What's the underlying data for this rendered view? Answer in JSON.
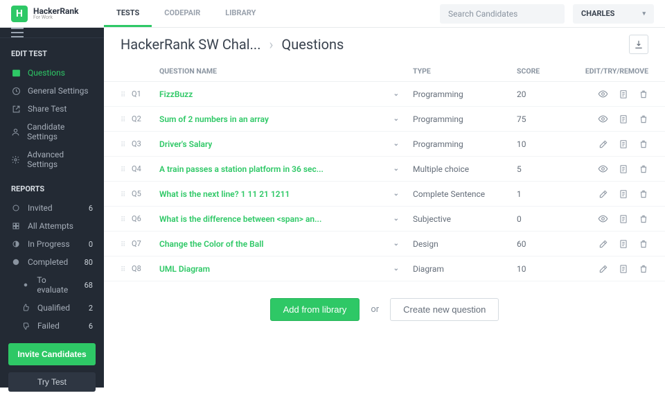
{
  "logo": {
    "brand": "HackerRank",
    "sub": "For Work"
  },
  "topnav": {
    "items": [
      "TESTS",
      "CODEPAIR",
      "LIBRARY"
    ],
    "active": 0
  },
  "search": {
    "placeholder": "Search Candidates"
  },
  "user": {
    "name": "CHARLES"
  },
  "sidebar": {
    "edit_title": "EDIT TEST",
    "edit_items": [
      {
        "label": "Questions",
        "icon": "list",
        "active": true
      },
      {
        "label": "General Settings",
        "icon": "clock"
      },
      {
        "label": "Share Test",
        "icon": "share"
      },
      {
        "label": "Candidate Settings",
        "icon": "user"
      },
      {
        "label": "Advanced Settings",
        "icon": "gear"
      }
    ],
    "reports_title": "REPORTS",
    "reports_items": [
      {
        "label": "Invited",
        "count": "6",
        "icon": "circle-open"
      },
      {
        "label": "All Attempts",
        "count": "",
        "icon": "grid"
      },
      {
        "label": "In Progress",
        "count": "0",
        "icon": "half"
      },
      {
        "label": "Completed",
        "count": "80",
        "icon": "circle-filled"
      },
      {
        "label": "To evaluate",
        "count": "68",
        "icon": "dot",
        "sub": true
      },
      {
        "label": "Qualified",
        "count": "2",
        "icon": "thumb-up",
        "sub": true
      },
      {
        "label": "Failed",
        "count": "6",
        "icon": "thumb-down",
        "sub": true
      }
    ],
    "invite_btn": "Invite Candidates",
    "try_btn": "Try Test"
  },
  "breadcrumb": {
    "test_name": "HackerRank SW Chal...",
    "page": "Questions"
  },
  "table": {
    "headers": {
      "name": "QUESTION NAME",
      "type": "TYPE",
      "score": "SCORE",
      "actions": "EDIT/TRY/REMOVE"
    },
    "rows": [
      {
        "q": "Q1",
        "name": "FizzBuzz",
        "type": "Programming",
        "score": "20",
        "first_action": "eye"
      },
      {
        "q": "Q2",
        "name": "Sum of 2 numbers in an array",
        "type": "Programming",
        "score": "75",
        "first_action": "eye"
      },
      {
        "q": "Q3",
        "name": "Driver's Salary",
        "type": "Programming",
        "score": "10",
        "first_action": "edit"
      },
      {
        "q": "Q4",
        "name": "A train passes a station platform in 36 sec...",
        "type": "Multiple choice",
        "score": "5",
        "first_action": "eye"
      },
      {
        "q": "Q5",
        "name": "What is the next line? 1 11 21 1211",
        "type": "Complete Sentence",
        "score": "1",
        "first_action": "edit"
      },
      {
        "q": "Q6",
        "name": "What is the difference between <span> an...",
        "type": "Subjective",
        "score": "0",
        "first_action": "eye"
      },
      {
        "q": "Q7",
        "name": "Change the Color of the Ball",
        "type": "Design",
        "score": "60",
        "first_action": "edit"
      },
      {
        "q": "Q8",
        "name": "UML Diagram",
        "type": "Diagram",
        "score": "10",
        "first_action": "edit"
      }
    ]
  },
  "buttons": {
    "add_library": "Add from library",
    "or": "or",
    "create": "Create new question"
  }
}
